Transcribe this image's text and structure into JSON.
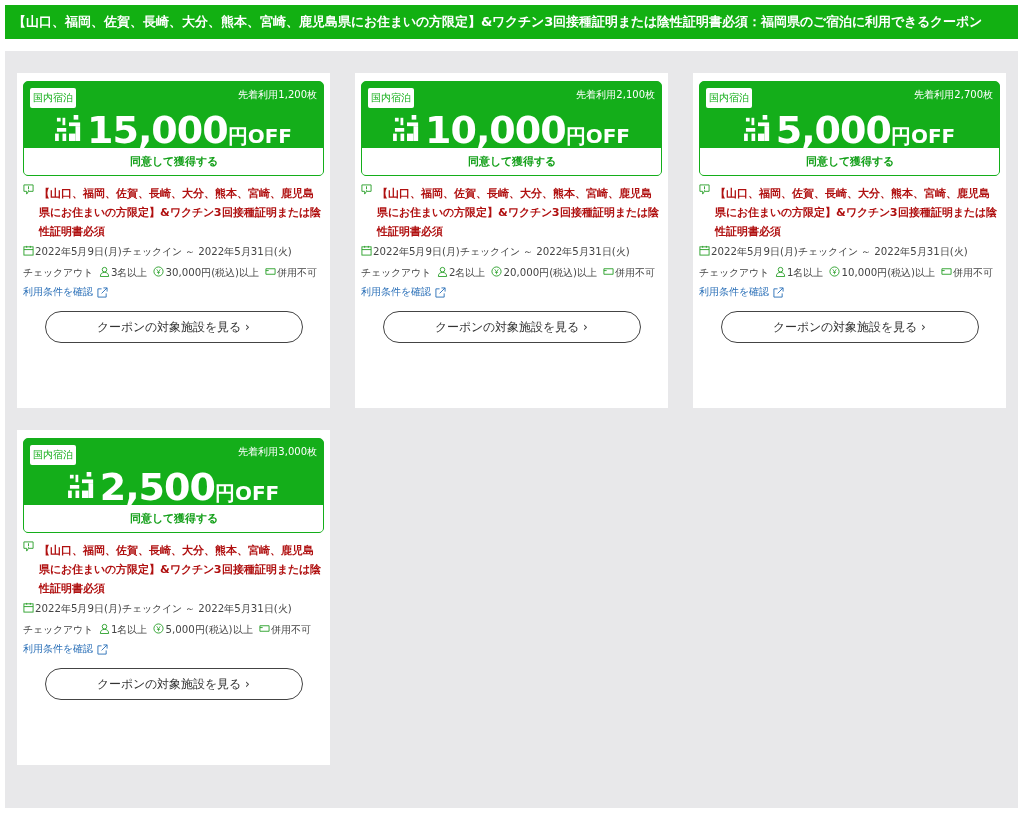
{
  "title": "【山口、福岡、佐賀、長崎、大分、熊本、宮崎、鹿児島県にお住まいの方限定】&ワクチン3回接種証明または陰性証明書必須：福岡県のご宿泊に利用できるクーポン",
  "coupons": [
    {
      "category": "国内宿泊",
      "remaining": "先着利用1,200枚",
      "amount": "15,000",
      "unit": "円OFF",
      "claim": "同意して獲得する",
      "notice": "【山口、福岡、佐賀、長崎、大分、熊本、宮崎、鹿児島県にお住まいの方限定】&ワクチン3回接種証明または陰性証明書必須",
      "period": "2022年5月9日(月)チェックイン ～ 2022年5月31日(火)",
      "period_end": "チェックアウト",
      "guests": "3名以上",
      "min_spend": "30,000円(税込)以上",
      "combine": "併用不可",
      "terms": "利用条件を確認",
      "facilities": "クーポンの対象施設を見る ›"
    },
    {
      "category": "国内宿泊",
      "remaining": "先着利用2,100枚",
      "amount": "10,000",
      "unit": "円OFF",
      "claim": "同意して獲得する",
      "notice": "【山口、福岡、佐賀、長崎、大分、熊本、宮崎、鹿児島県にお住まいの方限定】&ワクチン3回接種証明または陰性証明書必須",
      "period": "2022年5月9日(月)チェックイン ～ 2022年5月31日(火)",
      "period_end": "チェックアウト",
      "guests": "2名以上",
      "min_spend": "20,000円(税込)以上",
      "combine": "併用不可",
      "terms": "利用条件を確認",
      "facilities": "クーポンの対象施設を見る ›"
    },
    {
      "category": "国内宿泊",
      "remaining": "先着利用2,700枚",
      "amount": "5,000",
      "unit": "円OFF",
      "claim": "同意して獲得する",
      "notice": "【山口、福岡、佐賀、長崎、大分、熊本、宮崎、鹿児島県にお住まいの方限定】&ワクチン3回接種証明または陰性証明書必須",
      "period": "2022年5月9日(月)チェックイン ～ 2022年5月31日(火)",
      "period_end": "チェックアウト",
      "guests": "1名以上",
      "min_spend": "10,000円(税込)以上",
      "combine": "併用不可",
      "terms": "利用条件を確認",
      "facilities": "クーポンの対象施設を見る ›"
    },
    {
      "category": "国内宿泊",
      "remaining": "先着利用3,000枚",
      "amount": "2,500",
      "unit": "円OFF",
      "claim": "同意して獲得する",
      "notice": "【山口、福岡、佐賀、長崎、大分、熊本、宮崎、鹿児島県にお住まいの方限定】&ワクチン3回接種証明または陰性証明書必須",
      "period": "2022年5月9日(月)チェックイン ～ 2022年5月31日(火)",
      "period_end": "チェックアウト",
      "guests": "1名以上",
      "min_spend": "5,000円(税込)以上",
      "combine": "併用不可",
      "terms": "利用条件を確認",
      "facilities": "クーポンの対象施設を見る ›"
    }
  ]
}
